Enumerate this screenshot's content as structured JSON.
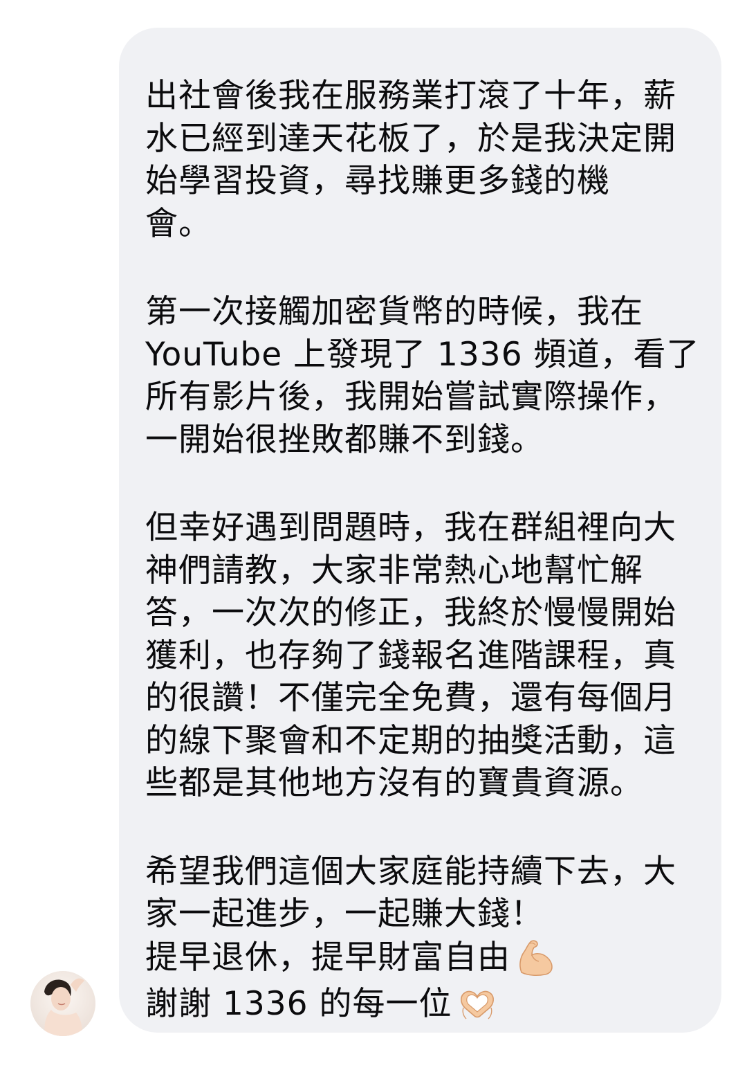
{
  "message": {
    "paragraphs": [
      "出社會後我在服務業打滾了十年，薪\n水已經到達天花板了，於是我決定開\n始學習投資，尋找賺更多錢的機\n會。",
      "第一次接觸加密貨幣的時候，我在\n YouTube 上發現了 1336 頻道，看了\n所有影片後，我開始嘗試實際操作，\n一開始很挫敗都賺不到錢。",
      "但幸好遇到問題時，我在群組裡向大\n神們請教，大家非常熱心地幫忙解\n答，一次次的修正，我終於慢慢開始\n獲利，也存夠了錢報名進階課程，真\n的很讚！不僅完全免費，還有每個月\n的線下聚會和不定期的抽獎活動，這\n些都是其他地方沒有的寶貴資源。",
      "希望我們這個大家庭能持續下去，大\n家一起進步，一起賺大錢！"
    ],
    "line_retire": "提早退休，提早財富自由",
    "line_thanks": "謝謝 1336 的每一位",
    "emoji_retire": "flexed-biceps-emoji",
    "emoji_thanks": "heart-hands-emoji"
  },
  "sender": {
    "avatar_icon": "user-avatar"
  },
  "colors": {
    "bubble": "#f0f1f4",
    "text": "#0b0b0d",
    "emoji_skin": "#f5c9a0"
  }
}
